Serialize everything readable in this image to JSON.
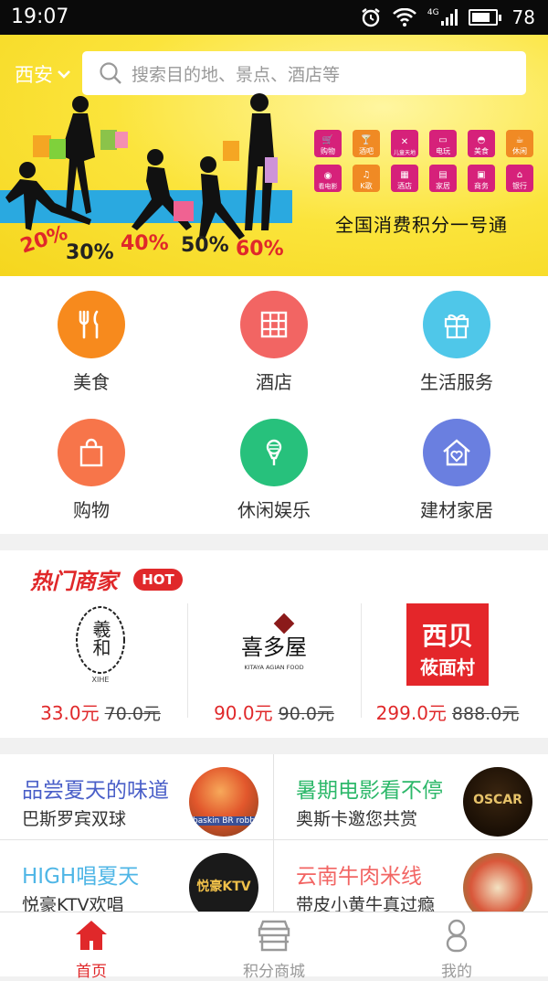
{
  "status_bar": {
    "time": "19:07",
    "network": "4G",
    "battery": "78"
  },
  "header": {
    "city": "西安",
    "search_placeholder": "搜索目的地、景点、酒店等"
  },
  "banner": {
    "discounts": [
      "20%",
      "30%",
      "40%",
      "50%",
      "60%"
    ],
    "mini_icons": [
      {
        "label": "购物",
        "color": "#d6217a"
      },
      {
        "label": "酒吧",
        "color": "#f08a24"
      },
      {
        "label": "儿童天地",
        "color": "#d6217a"
      },
      {
        "label": "电玩",
        "color": "#d6217a"
      },
      {
        "label": "美食",
        "color": "#d6217a"
      },
      {
        "label": "休闲",
        "color": "#f08a24"
      },
      {
        "label": "看电影",
        "color": "#d6217a"
      },
      {
        "label": "K歌",
        "color": "#f08a24"
      },
      {
        "label": "酒店",
        "color": "#d6217a"
      },
      {
        "label": "家居",
        "color": "#d6217a"
      },
      {
        "label": "商务",
        "color": "#d6217a"
      },
      {
        "label": "银行",
        "color": "#d6217a"
      }
    ],
    "slogan": "全国消费积分一号通"
  },
  "categories": [
    {
      "label": "美食",
      "icon": "fork-knife-icon",
      "color": "#f78a1d"
    },
    {
      "label": "酒店",
      "icon": "building-icon",
      "color": "#f26563"
    },
    {
      "label": "生活服务",
      "icon": "gift-icon",
      "color": "#4fc7e9"
    },
    {
      "label": "购物",
      "icon": "shopping-bag-icon",
      "color": "#f7754a"
    },
    {
      "label": "休闲娱乐",
      "icon": "microphone-icon",
      "color": "#27c17c"
    },
    {
      "label": "建材家居",
      "icon": "home-heart-icon",
      "color": "#6a7fe0"
    }
  ],
  "hot_merchants": {
    "title": "热门商家",
    "badge": "HOT",
    "items": [
      {
        "logo_text": "羲和",
        "logo_sub": "XIHE",
        "price": "33.0元",
        "original_price": "70.0元"
      },
      {
        "logo_text": "喜多屋",
        "logo_sub": "KITAYA AGIAN FOOD",
        "price": "90.0元",
        "original_price": "90.0元"
      },
      {
        "logo_text": "西贝",
        "logo_sub": "莜面村",
        "price": "299.0元",
        "original_price": "888.0元"
      }
    ]
  },
  "promos": [
    {
      "title": "品尝夏天的味道",
      "subtitle": "巴斯罗宾双球",
      "title_color": "#4a5fc8",
      "image_text": "baskin BR robb"
    },
    {
      "title": "暑期电影看不停",
      "subtitle": "奥斯卡邀您共赏",
      "title_color": "#2db86a",
      "image_text": "OSCAR"
    },
    {
      "title": "HIGH唱夏天",
      "subtitle": "悦豪KTV欢唱",
      "title_color": "#4fb6e6",
      "image_text": "悦豪KTV"
    },
    {
      "title": "云南牛肉米线",
      "subtitle": "带皮小黄牛真过瘾",
      "title_color": "#f26563",
      "image_text": ""
    }
  ],
  "tabs": [
    {
      "label": "首页",
      "icon": "home-icon",
      "active": true
    },
    {
      "label": "积分商城",
      "icon": "store-icon",
      "active": false
    },
    {
      "label": "我的",
      "icon": "user-icon",
      "active": false
    }
  ],
  "colors": {
    "accent": "#e0282a",
    "banner_yellow": "#fbe43b"
  }
}
